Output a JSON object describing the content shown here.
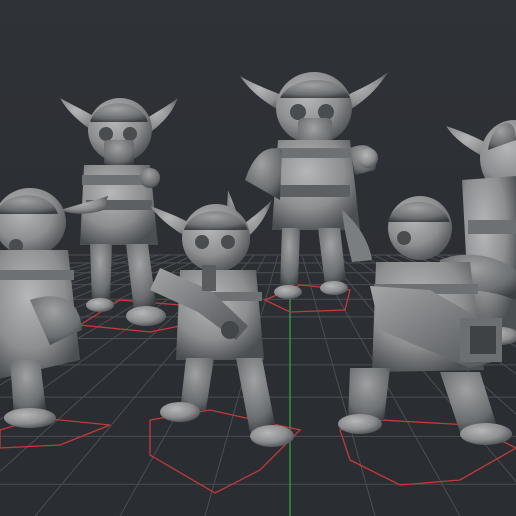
{
  "viewport": {
    "background": "#2b2e33",
    "grid_color": "#4a4d52",
    "axis_green": "#39a845",
    "axis_red": "#c23a3a",
    "model_color": "#8f9192",
    "footprint_color": "#c23a3a"
  },
  "models": [
    {
      "name": "gremlin-back-left",
      "pose": "standing-goggles-mask"
    },
    {
      "name": "gremlin-back-center",
      "pose": "standing-goggles-mask-flag"
    },
    {
      "name": "gremlin-back-right",
      "pose": "partial-edge"
    },
    {
      "name": "gremlin-front-left",
      "pose": "crouching-partial-edge"
    },
    {
      "name": "gremlin-front-center",
      "pose": "kneeling-rifle"
    },
    {
      "name": "gremlin-front-right",
      "pose": "kneeling-heavy-gun"
    }
  ]
}
